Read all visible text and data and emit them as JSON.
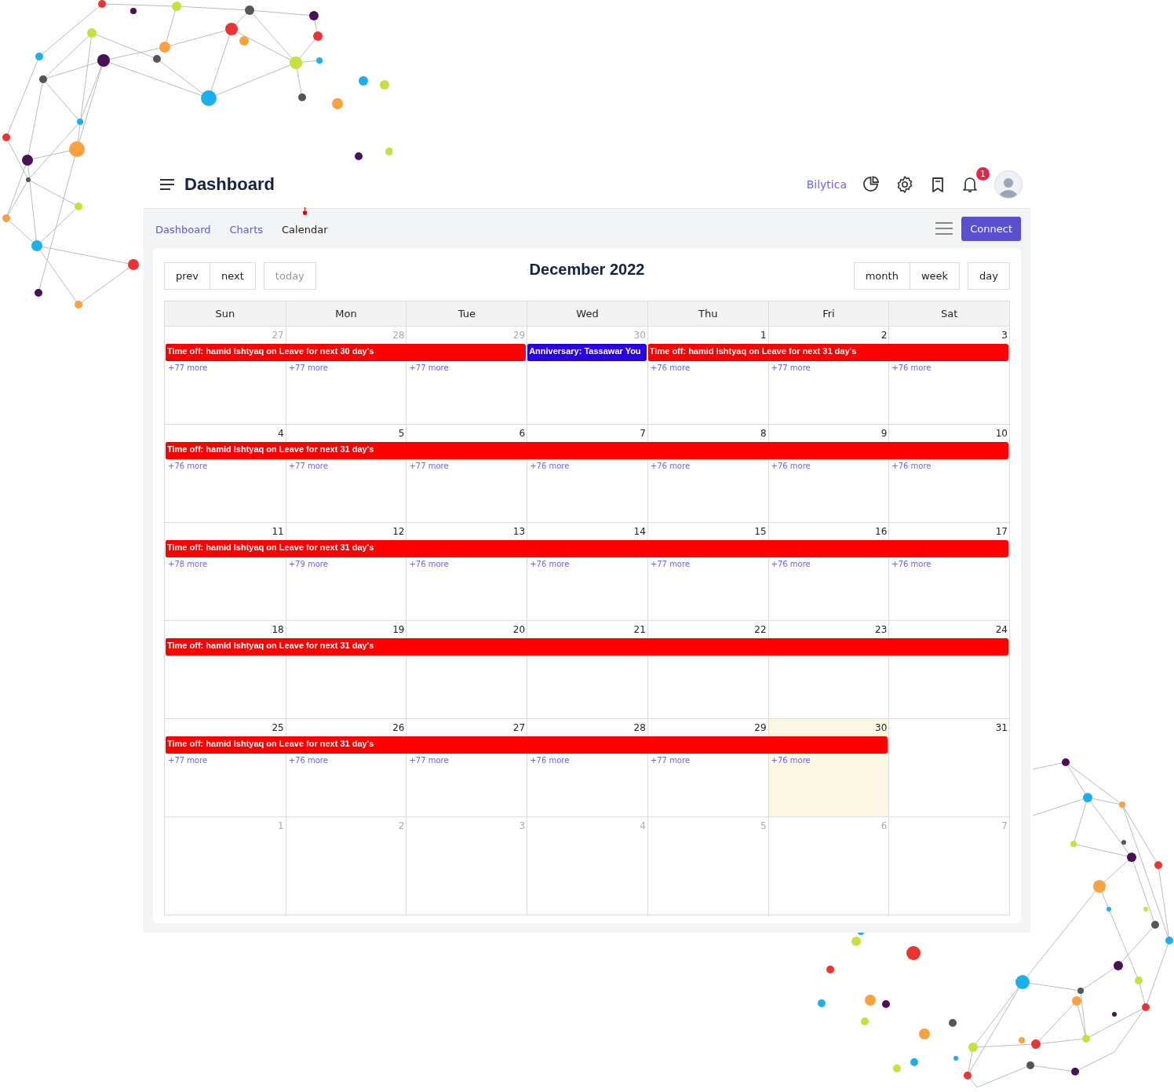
{
  "header": {
    "title": "Dashboard",
    "brand": "Bilytica",
    "notification_count": "1"
  },
  "nav": {
    "tabs": [
      {
        "label": "Dashboard",
        "selected": false
      },
      {
        "label": "Charts",
        "selected": false
      },
      {
        "label": "Calendar",
        "selected": true
      }
    ],
    "connect_button": "Connect"
  },
  "calendar": {
    "title": "December 2022",
    "nav_buttons": [
      {
        "label": "prev",
        "disabled": false
      },
      {
        "label": "next",
        "disabled": false
      }
    ],
    "today_button": {
      "label": "today",
      "disabled": true
    },
    "view_buttons": [
      {
        "label": "month"
      },
      {
        "label": "week"
      }
    ],
    "day_button": {
      "label": "day"
    },
    "weekdays": [
      "Sun",
      "Mon",
      "Tue",
      "Wed",
      "Thu",
      "Fri",
      "Sat"
    ],
    "weeks": [
      {
        "days": [
          {
            "num": "27",
            "other_month": true,
            "today": false,
            "covered": true,
            "event": {
              "title": "Time off: hamid Ishtyaq on Leave for next 30 day's",
              "color": "#ff0000"
            },
            "more": "+77 more"
          },
          {
            "num": "28",
            "other_month": true,
            "today": false,
            "covered": true,
            "more": "+77 more"
          },
          {
            "num": "29",
            "other_month": true,
            "today": false,
            "covered": true,
            "more": "+77 more"
          },
          {
            "num": "30",
            "other_month": true,
            "today": false,
            "covered": true,
            "event": {
              "title": "Anniversary: Tassawar You",
              "color": "#2a00e0"
            }
          },
          {
            "num": "1",
            "other_month": false,
            "today": false,
            "covered": true,
            "event": {
              "title": "Time off: hamid Ishtyaq on Leave for next 31 day's",
              "color": "#ff0000"
            },
            "more": "+76 more"
          },
          {
            "num": "2",
            "other_month": false,
            "today": false,
            "covered": true,
            "more": "+77 more"
          },
          {
            "num": "3",
            "other_month": false,
            "today": false,
            "covered": true,
            "more": "+76 more"
          }
        ]
      },
      {
        "days": [
          {
            "num": "4",
            "other_month": false,
            "today": false,
            "covered": true,
            "event": {
              "title": "Time off: hamid Ishtyaq on Leave for next 31 day's",
              "color": "#ff0000"
            },
            "more": "+76 more"
          },
          {
            "num": "5",
            "other_month": false,
            "today": false,
            "covered": true,
            "more": "+77 more"
          },
          {
            "num": "6",
            "other_month": false,
            "today": false,
            "covered": true,
            "more": "+77 more"
          },
          {
            "num": "7",
            "other_month": false,
            "today": false,
            "covered": true,
            "more": "+76 more"
          },
          {
            "num": "8",
            "other_month": false,
            "today": false,
            "covered": true,
            "more": "+76 more"
          },
          {
            "num": "9",
            "other_month": false,
            "today": false,
            "covered": true,
            "more": "+76 more"
          },
          {
            "num": "10",
            "other_month": false,
            "today": false,
            "covered": true,
            "more": "+76 more"
          }
        ]
      },
      {
        "days": [
          {
            "num": "11",
            "other_month": false,
            "today": false,
            "covered": true,
            "event": {
              "title": "Time off: hamid Ishtyaq on Leave for next 31 day's",
              "color": "#ff0000"
            },
            "more": "+78 more"
          },
          {
            "num": "12",
            "other_month": false,
            "today": false,
            "covered": true,
            "more": "+79 more"
          },
          {
            "num": "13",
            "other_month": false,
            "today": false,
            "covered": true,
            "more": "+76 more"
          },
          {
            "num": "14",
            "other_month": false,
            "today": false,
            "covered": true,
            "more": "+76 more"
          },
          {
            "num": "15",
            "other_month": false,
            "today": false,
            "covered": true,
            "more": "+77 more"
          },
          {
            "num": "16",
            "other_month": false,
            "today": false,
            "covered": true,
            "more": "+76 more"
          },
          {
            "num": "17",
            "other_month": false,
            "today": false,
            "covered": true,
            "more": "+76 more"
          }
        ]
      },
      {
        "days": [
          {
            "num": "18",
            "other_month": false,
            "today": false,
            "covered": true,
            "event": {
              "title": "Time off: hamid Ishtyaq on Leave for next 31 day's",
              "color": "#ff0000"
            }
          },
          {
            "num": "19",
            "other_month": false,
            "today": false,
            "covered": true
          },
          {
            "num": "20",
            "other_month": false,
            "today": false,
            "covered": true
          },
          {
            "num": "21",
            "other_month": false,
            "today": false,
            "covered": true
          },
          {
            "num": "22",
            "other_month": false,
            "today": false,
            "covered": true
          },
          {
            "num": "23",
            "other_month": false,
            "today": false,
            "covered": true
          },
          {
            "num": "24",
            "other_month": false,
            "today": false,
            "covered": true
          }
        ]
      },
      {
        "days": [
          {
            "num": "25",
            "other_month": false,
            "today": false,
            "covered": true,
            "event": {
              "title": "Time off: hamid Ishtyaq on Leave for next 31 day's",
              "color": "#ff0000"
            },
            "more": "+77 more"
          },
          {
            "num": "26",
            "other_month": false,
            "today": false,
            "covered": true,
            "more": "+76 more"
          },
          {
            "num": "27",
            "other_month": false,
            "today": false,
            "covered": true,
            "more": "+77 more"
          },
          {
            "num": "28",
            "other_month": false,
            "today": false,
            "covered": true,
            "more": "+76 more"
          },
          {
            "num": "29",
            "other_month": false,
            "today": false,
            "covered": true,
            "more": "+77 more"
          },
          {
            "num": "30",
            "other_month": false,
            "today": true,
            "covered": true,
            "more": "+76 more"
          },
          {
            "num": "31",
            "other_month": false,
            "today": false,
            "covered": false
          }
        ]
      },
      {
        "days": [
          {
            "num": "1",
            "other_month": true,
            "today": false,
            "covered": false
          },
          {
            "num": "2",
            "other_month": true,
            "today": false,
            "covered": false
          },
          {
            "num": "3",
            "other_month": true,
            "today": false,
            "covered": false
          },
          {
            "num": "4",
            "other_month": true,
            "today": false,
            "covered": false
          },
          {
            "num": "5",
            "other_month": true,
            "today": false,
            "covered": false
          },
          {
            "num": "6",
            "other_month": true,
            "today": false,
            "covered": false
          },
          {
            "num": "7",
            "other_month": true,
            "today": false,
            "covered": false
          }
        ]
      }
    ]
  }
}
